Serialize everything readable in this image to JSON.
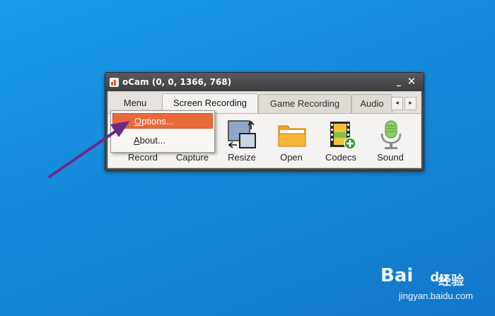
{
  "window": {
    "title": "oCam (0, 0, 1366, 768)",
    "minimize_label": "_",
    "close_label": "✕"
  },
  "tabs": {
    "menu_label": "Menu",
    "items": [
      {
        "label": "Screen Recording",
        "active": true
      },
      {
        "label": "Game Recording",
        "active": false
      },
      {
        "label": "Audio",
        "active": false
      }
    ],
    "scroll_left": "◂",
    "scroll_right": "▸"
  },
  "toolbar": {
    "items": [
      {
        "label": "Record",
        "icon": "record-icon"
      },
      {
        "label": "Capture",
        "icon": "capture-icon"
      },
      {
        "label": "Resize",
        "icon": "resize-icon"
      },
      {
        "label": "Open",
        "icon": "folder-icon"
      },
      {
        "label": "Codecs",
        "icon": "codecs-icon"
      },
      {
        "label": "Sound",
        "icon": "microphone-icon"
      }
    ]
  },
  "menu_dropdown": {
    "items": [
      {
        "label_underlined": "O",
        "label_rest": "ptions...",
        "highlighted": true
      },
      {
        "label_underlined": "A",
        "label_rest": "bout...",
        "highlighted": false
      }
    ]
  },
  "annotation": {
    "color": "#6b2a8a"
  },
  "watermark": {
    "logo_text": "Bai",
    "logo_text2": "du",
    "logo_text3": "经验",
    "url": "jingyan.baidu.com"
  },
  "colors": {
    "desktop": "#1a8fe0",
    "highlight": "#e86a3a"
  }
}
